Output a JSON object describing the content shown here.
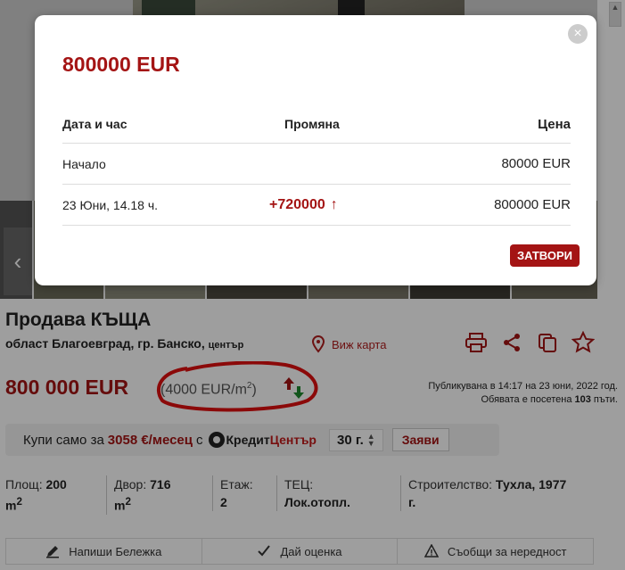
{
  "modal": {
    "title": "800000 EUR",
    "headers": {
      "date": "Дата и час",
      "change": "Промяна",
      "price": "Цена"
    },
    "rows": [
      {
        "date": "Начало",
        "change": "",
        "price": "80000 EUR"
      },
      {
        "date": "23 Юни, 14.18 ч.",
        "change": "+720000",
        "price": "800000 EUR"
      }
    ],
    "close_label": "ЗАТВОРИ"
  },
  "listing": {
    "title": "Продава КЪЩА",
    "location": "област Благоевград, гр. Банско,",
    "location_suffix": "център",
    "map_link": "Виж карта",
    "price": "800 000 EUR",
    "price_per_sqm": "(4000 EUR/m",
    "price_per_sqm_sup": "2",
    "price_per_sqm_end": ")",
    "published_line1": "Публикувана в 14:17 на 23 юни, 2022 год.",
    "published_line2_prefix": "Обявата е посетена",
    "visits": "103",
    "published_line2_suffix": "пъти."
  },
  "loan": {
    "prefix": "Купи само за",
    "amount": "3058 €/месец",
    "with": "с",
    "brand_black": "Кредит",
    "brand_red": "Център",
    "years": "30 г.",
    "button": "Заяви"
  },
  "attributes": [
    {
      "label": "Площ:",
      "value": "200",
      "unit": "m",
      "sup": "2"
    },
    {
      "label": "Двор:",
      "value": "716",
      "unit": "m",
      "sup": "2"
    },
    {
      "label": "Етаж:",
      "value": "2"
    },
    {
      "label": "ТЕЦ:",
      "value": "Лок.отопл."
    },
    {
      "label": "Строителство:",
      "value": "Тухла, 1977",
      "value2": "г."
    }
  ],
  "actions": [
    {
      "label": "Напиши Бележка",
      "icon": "pencil-icon"
    },
    {
      "label": "Дай оценка",
      "icon": "checkmark-icon"
    },
    {
      "label": "Съобщи за нередност",
      "icon": "warning-icon"
    }
  ],
  "colors": {
    "brand_red": "#a41414",
    "overlay": "rgba(0,0,0,0.38)"
  }
}
